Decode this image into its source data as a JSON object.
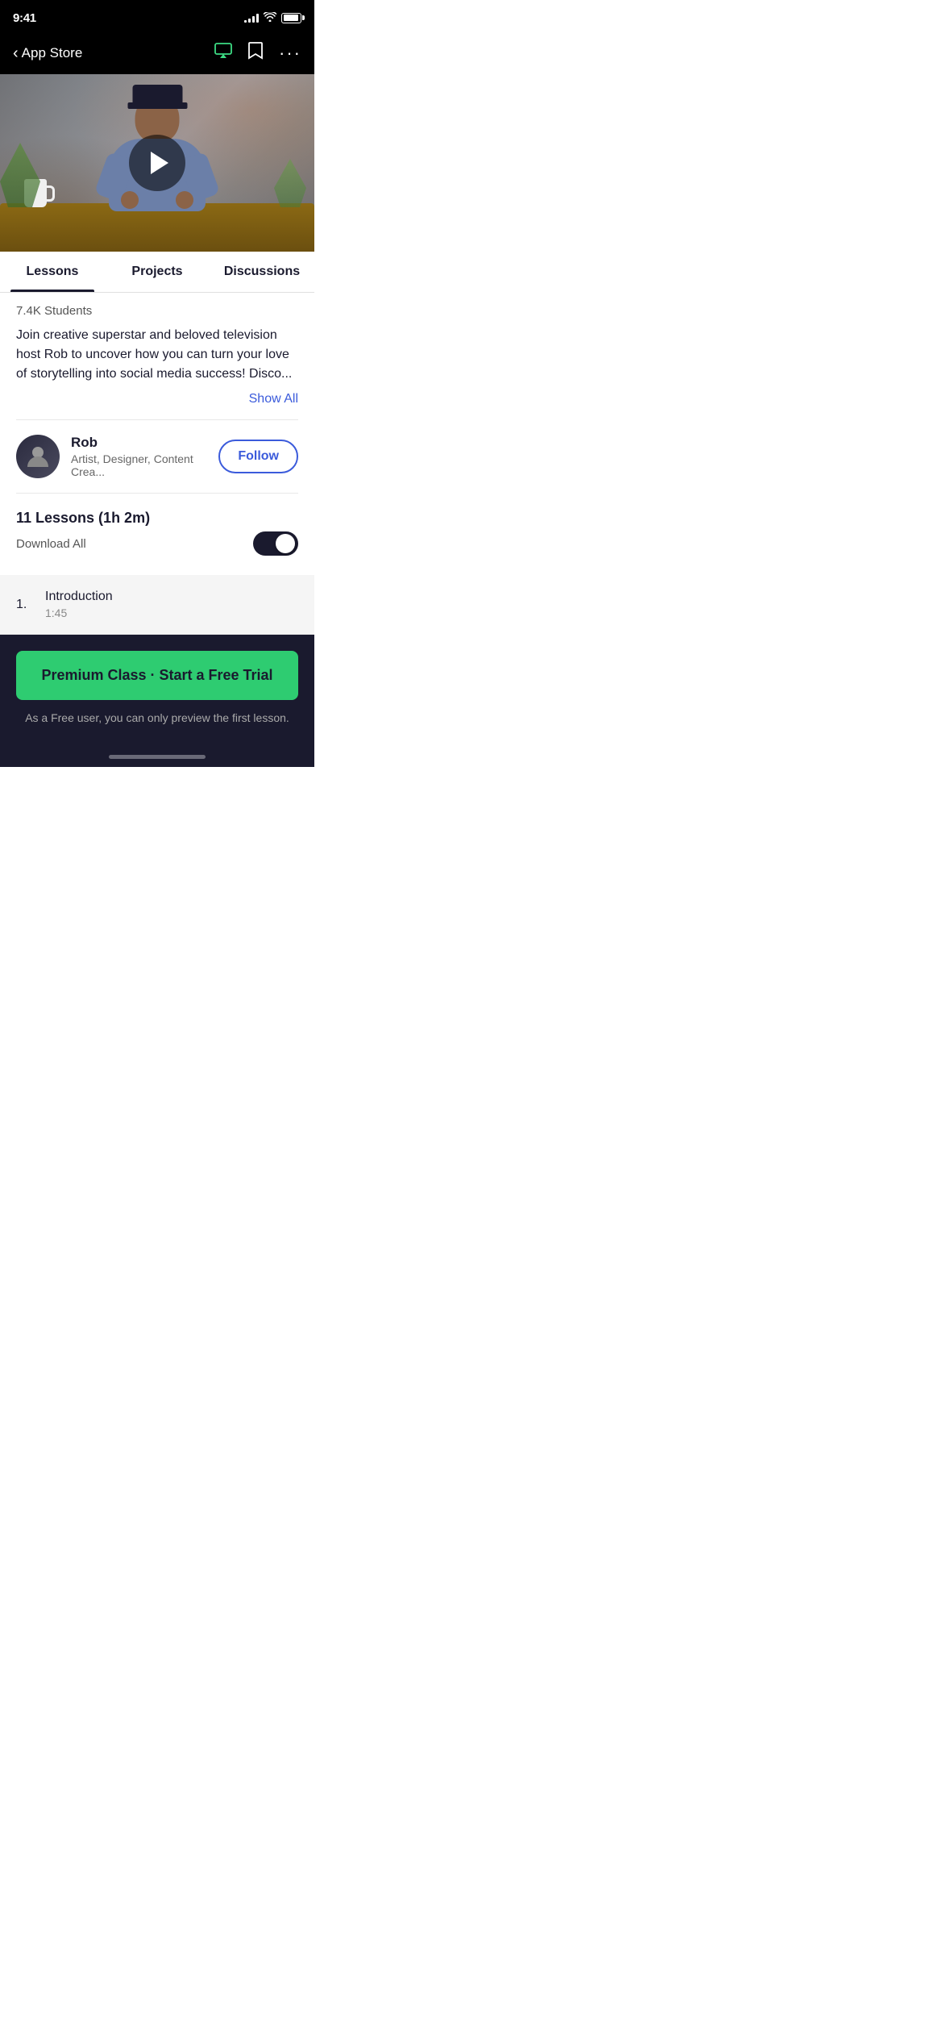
{
  "statusBar": {
    "time": "9:41",
    "backLabel": "App Store"
  },
  "videoArea": {
    "playButtonAriaLabel": "Play Video"
  },
  "tabs": [
    {
      "id": "lessons",
      "label": "Lessons",
      "active": true
    },
    {
      "id": "projects",
      "label": "Projects",
      "active": false
    },
    {
      "id": "discussions",
      "label": "Discussions",
      "active": false
    }
  ],
  "course": {
    "studentsText": "7.4K Students",
    "description": "Join creative superstar and beloved television host Rob to uncover how you can turn your love of storytelling into social media success!  Disco...",
    "showAllLabel": "Show All"
  },
  "instructor": {
    "name": "Rob",
    "title": "Artist, Designer, Content Crea...",
    "followLabel": "Follow"
  },
  "lessonsSection": {
    "header": "11 Lessons (1h 2m)",
    "downloadAll": "Download All",
    "lessons": [
      {
        "number": "1.",
        "title": "Introduction",
        "duration": "1:45"
      }
    ]
  },
  "cta": {
    "buttonLabel": "Premium Class · Start a Free Trial",
    "subtitle": "As a Free user, you can only preview the first lesson."
  }
}
